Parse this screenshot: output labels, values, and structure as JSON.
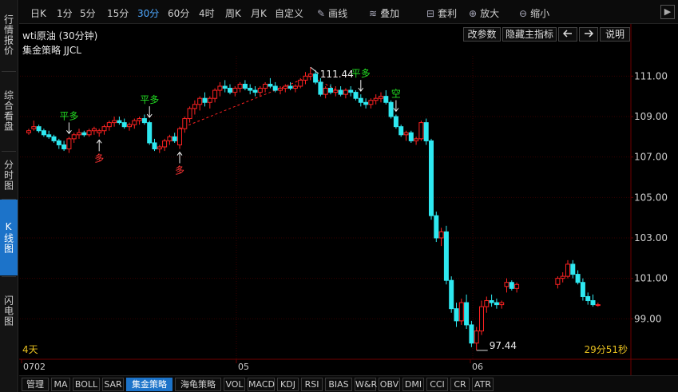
{
  "sidebar": {
    "tabs": [
      {
        "label": "行情报价",
        "name": "side-tab-quotes"
      },
      {
        "label": "综合看盘",
        "name": "side-tab-overview"
      },
      {
        "label": "分时图",
        "name": "side-tab-timeshare"
      },
      {
        "label": "K线图",
        "name": "side-tab-kline",
        "active": true
      },
      {
        "label": "闪电图",
        "name": "side-tab-flash"
      }
    ]
  },
  "toolbar": {
    "periods": [
      "日K",
      "1分",
      "5分",
      "15分",
      "30分",
      "60分",
      "4时",
      "周K",
      "月K",
      "自定义"
    ],
    "active_period": "30分",
    "draw_label": "画线",
    "overlay_label": "叠加",
    "arbitrage_label": "套利",
    "zoom_in_label": "放大",
    "zoom_out_label": "缩小"
  },
  "header": {
    "title": "wti原油 (30分钟)",
    "strategy": "集金策略 JJCL",
    "params_label": "改参数",
    "hide_indicator_label": "隐藏主指标",
    "prev_label": "◀",
    "next_label": "▶",
    "help_label": "说明"
  },
  "chart_data": {
    "type": "candlestick",
    "y_ticks": [
      "111.00",
      "109.00",
      "107.00",
      "105.00",
      "103.00",
      "101.00",
      "99.00"
    ],
    "x_labels": [
      "0702",
      "05",
      "06"
    ],
    "ylim": [
      97.0,
      112.0
    ],
    "grid": true,
    "annotations": {
      "high_label": "111.44",
      "low_label": "97.44",
      "signals": [
        {
          "text": "平多",
          "color": "#22dd22",
          "idx": 8,
          "pos": "above"
        },
        {
          "text": "多",
          "color": "#ff3333",
          "idx": 14,
          "pos": "below"
        },
        {
          "text": "平多",
          "color": "#22dd22",
          "idx": 24,
          "pos": "above"
        },
        {
          "text": "多",
          "color": "#ff3333",
          "idx": 30,
          "pos": "below"
        },
        {
          "text": "平多",
          "color": "#22dd22",
          "idx": 66,
          "pos": "above"
        },
        {
          "text": "空",
          "color": "#22dd22",
          "idx": 73,
          "pos": "above"
        }
      ]
    },
    "candles": [
      [
        108.2,
        108.4,
        108.1,
        108.3
      ],
      [
        108.4,
        108.8,
        108.3,
        108.5
      ],
      [
        108.5,
        108.6,
        108.2,
        108.3
      ],
      [
        108.3,
        108.4,
        108.0,
        108.1
      ],
      [
        108.1,
        108.3,
        107.9,
        108.0
      ],
      [
        108.0,
        108.1,
        107.7,
        107.8
      ],
      [
        107.8,
        107.9,
        107.4,
        107.6
      ],
      [
        107.6,
        107.8,
        107.3,
        107.4
      ],
      [
        107.4,
        108.0,
        107.2,
        107.9
      ],
      [
        107.9,
        108.2,
        107.7,
        108.1
      ],
      [
        108.1,
        108.4,
        107.9,
        108.2
      ],
      [
        108.2,
        108.3,
        108.0,
        108.1
      ],
      [
        108.1,
        108.4,
        108.0,
        108.3
      ],
      [
        108.3,
        108.5,
        108.1,
        108.4
      ],
      [
        108.2,
        108.4,
        108.0,
        108.3
      ],
      [
        108.3,
        108.6,
        108.1,
        108.5
      ],
      [
        108.5,
        108.8,
        108.3,
        108.7
      ],
      [
        108.7,
        109.0,
        108.5,
        108.8
      ],
      [
        108.8,
        109.0,
        108.6,
        108.7
      ],
      [
        108.7,
        108.9,
        108.4,
        108.5
      ],
      [
        108.5,
        108.7,
        108.3,
        108.6
      ],
      [
        108.6,
        108.9,
        108.4,
        108.8
      ],
      [
        108.8,
        109.0,
        108.6,
        108.9
      ],
      [
        108.9,
        109.1,
        108.6,
        108.7
      ],
      [
        108.7,
        108.8,
        107.6,
        107.7
      ],
      [
        107.7,
        107.9,
        107.3,
        107.4
      ],
      [
        107.4,
        107.6,
        107.2,
        107.5
      ],
      [
        107.5,
        107.9,
        107.3,
        107.8
      ],
      [
        107.8,
        108.1,
        107.6,
        108.0
      ],
      [
        108.0,
        108.2,
        107.7,
        107.8
      ],
      [
        107.6,
        108.5,
        107.4,
        108.4
      ],
      [
        108.4,
        109.0,
        108.2,
        108.9
      ],
      [
        108.9,
        109.5,
        108.7,
        109.4
      ],
      [
        109.4,
        109.8,
        109.1,
        109.6
      ],
      [
        109.6,
        110.0,
        109.3,
        109.9
      ],
      [
        109.9,
        110.2,
        109.5,
        109.7
      ],
      [
        109.7,
        110.0,
        109.4,
        109.9
      ],
      [
        109.9,
        110.4,
        109.7,
        110.3
      ],
      [
        110.3,
        110.7,
        110.0,
        110.5
      ],
      [
        110.5,
        110.8,
        110.2,
        110.4
      ],
      [
        110.4,
        110.6,
        110.1,
        110.2
      ],
      [
        110.2,
        110.5,
        110.0,
        110.4
      ],
      [
        110.4,
        110.7,
        110.2,
        110.6
      ],
      [
        110.6,
        110.8,
        110.3,
        110.4
      ],
      [
        110.4,
        110.6,
        110.1,
        110.3
      ],
      [
        110.3,
        110.5,
        110.0,
        110.2
      ],
      [
        110.2,
        110.5,
        110.0,
        110.4
      ],
      [
        110.4,
        110.7,
        110.2,
        110.6
      ],
      [
        110.6,
        110.9,
        110.4,
        110.5
      ],
      [
        110.5,
        110.7,
        110.2,
        110.3
      ],
      [
        110.3,
        110.5,
        110.1,
        110.4
      ],
      [
        110.4,
        110.6,
        110.2,
        110.5
      ],
      [
        110.5,
        110.7,
        110.3,
        110.4
      ],
      [
        110.4,
        110.6,
        110.2,
        110.5
      ],
      [
        110.5,
        110.9,
        110.4,
        110.8
      ],
      [
        110.8,
        111.2,
        110.6,
        111.0
      ],
      [
        111.0,
        111.44,
        110.8,
        111.1
      ],
      [
        111.1,
        111.3,
        110.6,
        110.7
      ],
      [
        110.7,
        110.9,
        110.0,
        110.1
      ],
      [
        110.1,
        110.5,
        109.9,
        110.4
      ],
      [
        110.4,
        110.6,
        110.1,
        110.2
      ],
      [
        110.2,
        110.5,
        110.0,
        110.3
      ],
      [
        110.3,
        110.5,
        110.0,
        110.1
      ],
      [
        110.1,
        110.4,
        109.9,
        110.3
      ],
      [
        110.3,
        110.5,
        110.0,
        110.2
      ],
      [
        110.2,
        110.3,
        109.8,
        109.9
      ],
      [
        109.9,
        110.1,
        109.5,
        109.7
      ],
      [
        109.7,
        109.9,
        109.4,
        109.6
      ],
      [
        109.6,
        109.9,
        109.4,
        109.8
      ],
      [
        109.8,
        110.1,
        109.6,
        109.9
      ],
      [
        109.9,
        110.2,
        109.7,
        110.0
      ],
      [
        110.0,
        110.3,
        109.6,
        109.7
      ],
      [
        109.7,
        109.8,
        108.9,
        109.0
      ],
      [
        109.0,
        109.1,
        108.4,
        108.5
      ],
      [
        108.5,
        108.6,
        108.0,
        108.1
      ],
      [
        108.1,
        108.3,
        107.8,
        108.2
      ],
      [
        108.2,
        108.3,
        107.7,
        107.8
      ],
      [
        107.8,
        108.0,
        107.6,
        107.9
      ],
      [
        107.9,
        108.8,
        107.8,
        108.7
      ],
      [
        108.7,
        108.9,
        107.6,
        107.8
      ],
      [
        107.8,
        107.9,
        103.9,
        104.1
      ],
      [
        104.1,
        104.3,
        102.8,
        103.0
      ],
      [
        103.0,
        103.5,
        102.6,
        103.3
      ],
      [
        103.3,
        103.6,
        100.7,
        100.9
      ],
      [
        100.9,
        101.1,
        99.3,
        99.5
      ],
      [
        99.5,
        99.8,
        98.6,
        98.9
      ],
      [
        98.9,
        100.0,
        98.7,
        99.8
      ],
      [
        99.8,
        100.2,
        98.5,
        98.7
      ],
      [
        98.7,
        98.9,
        97.6,
        97.8
      ],
      [
        97.8,
        98.6,
        97.44,
        98.4
      ],
      [
        98.4,
        99.9,
        98.2,
        99.6
      ],
      [
        99.6,
        100.1,
        99.3,
        99.9
      ],
      [
        99.9,
        100.2,
        99.6,
        99.8
      ],
      [
        99.8,
        100.0,
        99.5,
        99.7
      ],
      [
        99.7,
        99.9,
        99.5,
        99.8
      ],
      [
        100.6,
        101.0,
        100.3,
        100.8
      ],
      [
        100.8,
        100.9,
        100.4,
        100.5
      ],
      [
        100.5,
        100.8,
        100.3,
        100.7
      ],
      [
        100.7,
        101.1,
        100.5,
        101.0
      ],
      [
        101.0,
        101.3,
        100.8,
        101.1
      ],
      [
        101.1,
        101.9,
        101.0,
        101.7
      ],
      [
        101.7,
        101.9,
        101.0,
        101.2
      ],
      [
        101.2,
        101.4,
        100.7,
        100.8
      ],
      [
        100.8,
        101.0,
        99.9,
        100.1
      ],
      [
        100.1,
        100.3,
        99.7,
        99.9
      ],
      [
        99.9,
        100.2,
        99.6,
        99.7
      ],
      [
        99.7,
        99.8,
        99.6,
        99.7
      ]
    ]
  },
  "footer": {
    "period_count": "4天",
    "countdown": "29分51秒"
  },
  "bottom_tabs": [
    "管理",
    "MA",
    "BOLL",
    "SAR",
    "集金策略",
    "海龟策略",
    "VOL",
    "MACD",
    "KDJ",
    "RSI",
    "BIAS",
    "W&R",
    "OBV",
    "DMI",
    "CCI",
    "CR",
    "ATR"
  ],
  "active_bottom_tab": "集金策略",
  "colors": {
    "up": "#ff2222",
    "down": "#2ee8f0",
    "grid": "#3a0000",
    "axis": "#6e0000",
    "signal_green": "#22dd22",
    "signal_red": "#ff3333",
    "accent": "#1c73c9"
  }
}
